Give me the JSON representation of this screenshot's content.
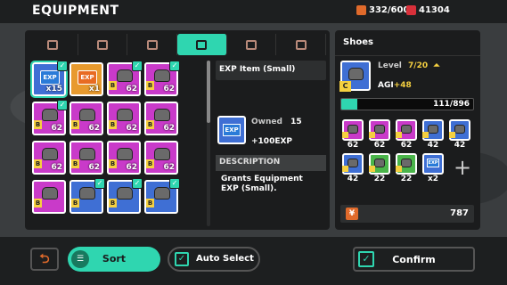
{
  "header": {
    "title": "EQUIPMENT",
    "energy": "332/600",
    "gems": "41304"
  },
  "tabs": [
    {
      "icon": "weapon-icon",
      "active": false
    },
    {
      "icon": "armor-icon",
      "active": false
    },
    {
      "icon": "helmet-icon",
      "active": false
    },
    {
      "icon": "shoes-icon",
      "active": true
    },
    {
      "icon": "ring-icon",
      "active": false
    },
    {
      "icon": "accessory-icon",
      "active": false
    }
  ],
  "grid": [
    {
      "type": "exp",
      "color": "blue",
      "label": "EXP",
      "qty": "x15",
      "checked": true,
      "selected": true
    },
    {
      "type": "exp",
      "color": "orange",
      "label": "EXP",
      "qty": "x1",
      "checked": false
    },
    {
      "type": "gear",
      "color": "purple",
      "qty": "62",
      "checked": true
    },
    {
      "type": "gear",
      "color": "purple",
      "qty": "62",
      "checked": true
    },
    {
      "type": "gear",
      "color": "purple",
      "qty": "62",
      "checked": true
    },
    {
      "type": "gear",
      "color": "purple",
      "qty": "62",
      "checked": false
    },
    {
      "type": "gear",
      "color": "purple",
      "qty": "62",
      "checked": false
    },
    {
      "type": "gear",
      "color": "purple",
      "qty": "62",
      "checked": false
    },
    {
      "type": "gear",
      "color": "purple",
      "qty": "62",
      "checked": false
    },
    {
      "type": "gear",
      "color": "purple",
      "qty": "62",
      "checked": false
    },
    {
      "type": "gear",
      "color": "purple",
      "qty": "62",
      "checked": false
    },
    {
      "type": "gear",
      "color": "purple",
      "qty": "62",
      "checked": false
    },
    {
      "type": "gear",
      "color": "purple",
      "qty": "",
      "checked": false
    },
    {
      "type": "gear",
      "color": "blue",
      "qty": "",
      "checked": true
    },
    {
      "type": "gear",
      "color": "blue",
      "qty": "",
      "checked": true
    },
    {
      "type": "gear",
      "color": "blue",
      "qty": "",
      "checked": true
    }
  ],
  "detail": {
    "name": "EXP Item (Small)",
    "owned_label": "Owned",
    "owned_value": "15",
    "bonus": "+100EXP",
    "desc_heading": "DESCRIPTION",
    "desc_text": "Grants Equipment EXP (Small)."
  },
  "target": {
    "name": "Shoes",
    "grade": "C",
    "level_label": "Level",
    "level_value": "7/20",
    "stat_label": "AGI",
    "stat_value": "+48",
    "xp_text": "111/896",
    "xp_fraction": 0.124
  },
  "materials": [
    {
      "color": "purple",
      "qty": "62"
    },
    {
      "color": "purple",
      "qty": "62"
    },
    {
      "color": "purple",
      "qty": "62"
    },
    {
      "color": "blue",
      "qty": "42"
    },
    {
      "color": "blue",
      "qty": "42"
    },
    {
      "color": "blue",
      "qty": "42"
    },
    {
      "color": "green",
      "qty": "22"
    },
    {
      "color": "green",
      "qty": "22"
    },
    {
      "color": "blue",
      "type": "exp",
      "label": "EXP",
      "qty": "x2"
    }
  ],
  "cost": {
    "value": "787"
  },
  "footer": {
    "sort": "Sort",
    "auto_select": "Auto Select",
    "confirm": "Confirm"
  },
  "colors": {
    "accent": "#2fd6b0",
    "purple": "#c93ac9",
    "blue": "#3f6fd4",
    "gold": "#f5d040",
    "coin": "#e06a2b"
  }
}
